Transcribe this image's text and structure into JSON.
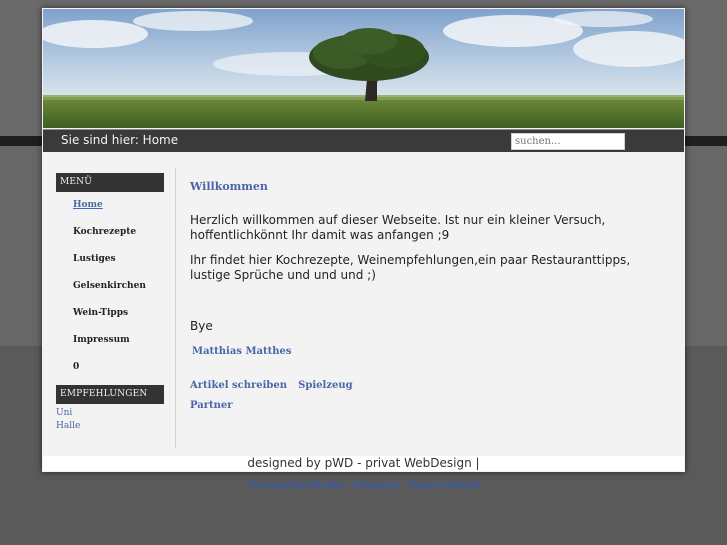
{
  "breadcrumb": {
    "text": "Sie sind hier: Home"
  },
  "search": {
    "placeholder": "suchen..."
  },
  "sidebar": {
    "menu_heading": "MENÜ",
    "items": [
      {
        "label": "Home",
        "active": true
      },
      {
        "label": "Kochrezepte"
      },
      {
        "label": "Lustiges"
      },
      {
        "label": "Gelsenkirchen"
      },
      {
        "label": "Wein-Tipps"
      },
      {
        "label": "Impressum"
      },
      {
        "label": "0"
      }
    ],
    "recommend_heading": "EMPFEHLUNGEN",
    "recommend_links": [
      "Uni",
      "Halle"
    ]
  },
  "main": {
    "title": "Willkommen",
    "paragraph1": "Herzlich willkommen auf dieser Webseite. Ist nur ein kleiner Versuch, hoffentlichkönnt Ihr damit was anfangen ;9",
    "paragraph2": "Ihr findet hier Kochrezepte, Weinempfehlungen,ein paar Restauranttipps, lustige Sprüche und und und ;)",
    "bye": "Bye",
    "signature": "Matthias Matthes",
    "links": [
      "Artikel schreiben",
      "Spielzeug"
    ],
    "partner": "Partner"
  },
  "footer": {
    "text": "designed by pWD - privat WebDesign |"
  },
  "bottom_links": [
    "Versandapotheke",
    "Einspray",
    "Tapeverband"
  ]
}
